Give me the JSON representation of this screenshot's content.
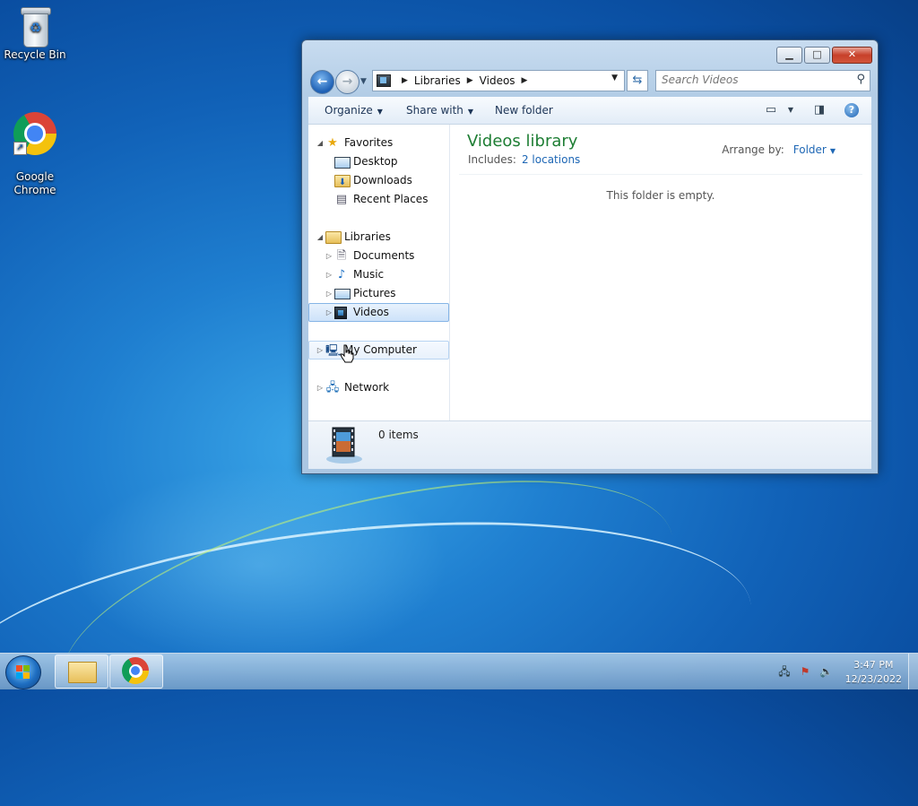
{
  "desktop": {
    "icons": [
      {
        "label": "Recycle Bin",
        "icon": "recycle-bin-icon"
      },
      {
        "label": "Google\nChrome",
        "icon": "chrome-icon"
      }
    ]
  },
  "window": {
    "address": {
      "crumbs": [
        "Libraries",
        "Videos"
      ]
    },
    "search": {
      "placeholder": "Search Videos"
    },
    "toolbar": {
      "organize": "Organize",
      "share_with": "Share with",
      "new_folder": "New folder"
    },
    "nav_pane": {
      "favorites": {
        "label": "Favorites",
        "items": [
          "Desktop",
          "Downloads",
          "Recent Places"
        ]
      },
      "libraries": {
        "label": "Libraries",
        "items": [
          "Documents",
          "Music",
          "Pictures",
          "Videos"
        ]
      },
      "my_computer": "My Computer",
      "network": "Network"
    },
    "library": {
      "title": "Videos library",
      "includes_label": "Includes:",
      "locations_link": "2 locations",
      "arrange_label": "Arrange by:",
      "arrange_value": "Folder",
      "empty_message": "This folder is empty."
    },
    "details": {
      "item_count": "0 items"
    }
  },
  "taskbar": {
    "clock": {
      "time": "3:47 PM",
      "date": "12/23/2022"
    }
  },
  "colors": {
    "library_title": "#1e7e34",
    "link": "#1e67b5",
    "selection": "#cde2f9"
  }
}
